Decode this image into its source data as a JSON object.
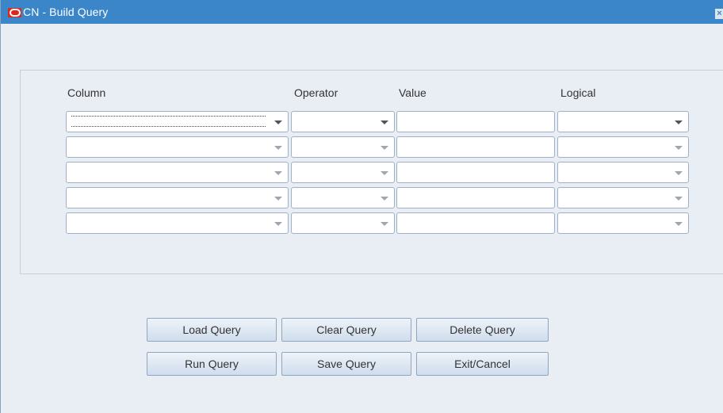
{
  "window": {
    "title": "CN - Build Query",
    "close_symbol": "×"
  },
  "columns": {
    "column": "Column",
    "operator": "Operator",
    "value": "Value",
    "logical": "Logical"
  },
  "rows": [
    {
      "column": "",
      "operator": "",
      "value": "",
      "logical": ""
    },
    {
      "column": "",
      "operator": "",
      "value": "",
      "logical": ""
    },
    {
      "column": "",
      "operator": "",
      "value": "",
      "logical": ""
    },
    {
      "column": "",
      "operator": "",
      "value": "",
      "logical": ""
    },
    {
      "column": "",
      "operator": "",
      "value": "",
      "logical": ""
    }
  ],
  "buttons": {
    "load": "Load Query",
    "clear": "Clear Query",
    "delete": "Delete Query",
    "run": "Run Query",
    "save": "Save Query",
    "exit": "Exit/Cancel"
  },
  "icons": {
    "app": "oracle-logo-icon",
    "close": "close-icon",
    "dropdown": "chevron-down-icon"
  },
  "colors": {
    "titlebar": "#3a86c8",
    "window_bg": "#e9eef5",
    "oracle_red": "#e1251b"
  }
}
